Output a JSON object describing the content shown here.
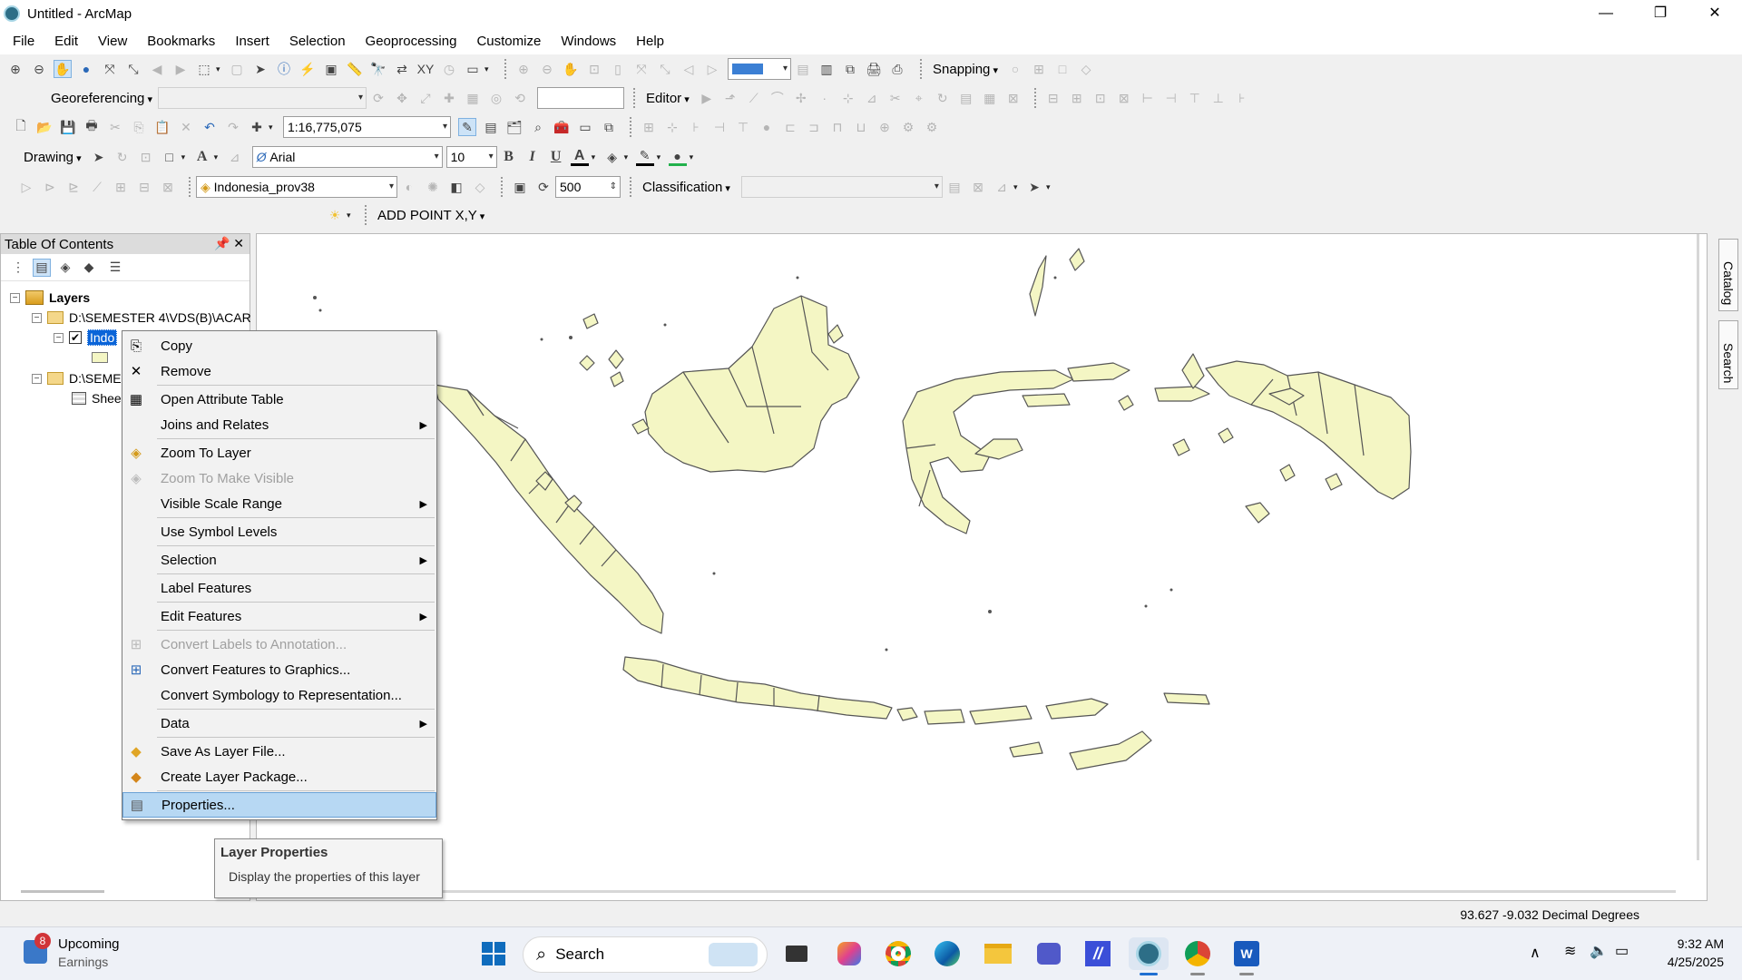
{
  "window": {
    "title": "Untitled - ArcMap",
    "controls": [
      "—",
      "❐",
      "✕"
    ]
  },
  "menu": [
    "File",
    "Edit",
    "View",
    "Bookmarks",
    "Insert",
    "Selection",
    "Geoprocessing",
    "Customize",
    "Windows",
    "Help"
  ],
  "toolbars": {
    "snapping_label": "Snapping",
    "georeferencing_label": "Georeferencing",
    "editor_label": "Editor",
    "scale_value": "1:16,775,075",
    "drawing_label": "Drawing",
    "font_name": "Arial",
    "font_size": "10",
    "bold": "B",
    "italic": "I",
    "underline": "U",
    "font_color_glyph": "A",
    "layer_select": "Indonesia_prov38",
    "reference_scale": "500",
    "classification_label": "Classification",
    "add_point_label": "ADD POINT X,Y"
  },
  "toc": {
    "title": "Table Of Contents",
    "root": "Layers",
    "folder1": "D:\\SEMESTER 4\\VDS(B)\\ACAR",
    "layer_name": "Indo",
    "folder2": "D:\\SEME",
    "table_name": "Shee"
  },
  "right_dock": {
    "catalog": "Catalog",
    "search": "Search"
  },
  "context_menu": [
    {
      "label": "Copy",
      "icon": "copy-icon",
      "glyph": "⎘",
      "disabled": false,
      "submenu": false
    },
    {
      "label": "Remove",
      "icon": "remove-icon",
      "glyph": "✕",
      "disabled": false,
      "submenu": false
    },
    {
      "label": "Open Attribute Table",
      "icon": "table-icon",
      "glyph": "▦",
      "disabled": false,
      "submenu": false
    },
    {
      "label": "Joins and Relates",
      "icon": "",
      "glyph": "",
      "disabled": false,
      "submenu": true
    },
    {
      "label": "Zoom To Layer",
      "icon": "zoom-layer-icon",
      "glyph": "◈",
      "disabled": false,
      "submenu": false
    },
    {
      "label": "Zoom To Make Visible",
      "icon": "zoom-visible-icon",
      "glyph": "◈",
      "disabled": true,
      "submenu": false
    },
    {
      "label": "Visible Scale Range",
      "icon": "",
      "glyph": "",
      "disabled": false,
      "submenu": true
    },
    {
      "label": "Use Symbol Levels",
      "icon": "",
      "glyph": "",
      "disabled": false,
      "submenu": false
    },
    {
      "label": "Selection",
      "icon": "",
      "glyph": "",
      "disabled": false,
      "submenu": true
    },
    {
      "label": "Label Features",
      "icon": "",
      "glyph": "",
      "disabled": false,
      "submenu": false
    },
    {
      "label": "Edit Features",
      "icon": "",
      "glyph": "",
      "disabled": false,
      "submenu": true
    },
    {
      "label": "Convert Labels to Annotation...",
      "icon": "convert-labels-icon",
      "glyph": "⊞",
      "disabled": true,
      "submenu": false
    },
    {
      "label": "Convert Features to Graphics...",
      "icon": "convert-graphics-icon",
      "glyph": "⊞",
      "disabled": false,
      "submenu": false
    },
    {
      "label": "Convert Symbology to Representation...",
      "icon": "",
      "glyph": "",
      "disabled": false,
      "submenu": false
    },
    {
      "label": "Data",
      "icon": "",
      "glyph": "",
      "disabled": false,
      "submenu": true
    },
    {
      "label": "Save As Layer File...",
      "icon": "save-layer-icon",
      "glyph": "◆",
      "disabled": false,
      "submenu": false
    },
    {
      "label": "Create Layer Package...",
      "icon": "layer-package-icon",
      "glyph": "◆",
      "disabled": false,
      "submenu": false
    },
    {
      "label": "Properties...",
      "icon": "properties-icon",
      "glyph": "▤",
      "disabled": false,
      "submenu": false,
      "highlighted": true
    }
  ],
  "tooltip": {
    "title": "Layer Properties",
    "text": "Display the properties of this layer"
  },
  "status": {
    "coordinates": "93.627  -9.032 Decimal Degrees"
  },
  "taskbar": {
    "notification_count": "8",
    "widget_title": "Upcoming",
    "widget_sub": "Earnings",
    "search_placeholder": "Search",
    "time": "9:32 AM",
    "date": "4/25/2025"
  },
  "colors": {
    "land_fill": "#f4f6c4",
    "land_stroke": "#555555",
    "selection_blue": "#0a64d8",
    "menu_highlight": "#b7d8f3"
  }
}
